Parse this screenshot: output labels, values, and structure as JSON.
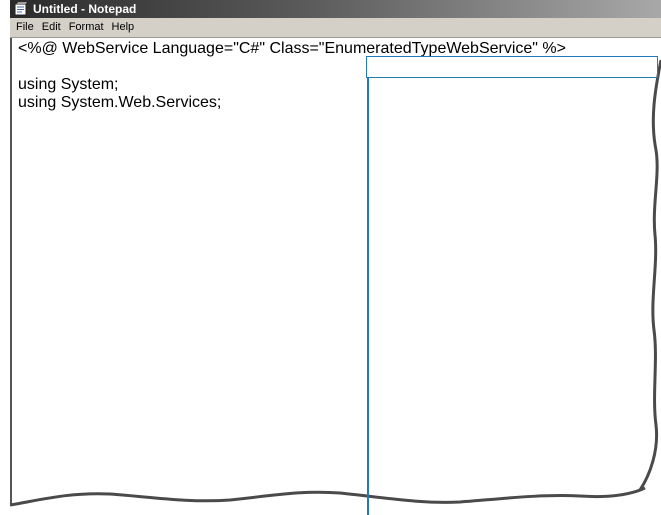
{
  "window": {
    "title": "Untitled - Notepad"
  },
  "menu": {
    "items": [
      {
        "label": "File"
      },
      {
        "label": "Edit"
      },
      {
        "label": "Format"
      },
      {
        "label": "Help"
      }
    ]
  },
  "editor": {
    "lines": [
      "<%@ WebService Language=\"C#\" Class=\"EnumeratedTypeWebService\" %>",
      "",
      "using System;",
      "using System.Web.Services;"
    ]
  },
  "colors": {
    "callout": "#1f7ab8",
    "titlebar_dark": "#2b2b2b",
    "menubar": "#d4d0c8"
  },
  "icons": {
    "app": "notepad-icon"
  }
}
